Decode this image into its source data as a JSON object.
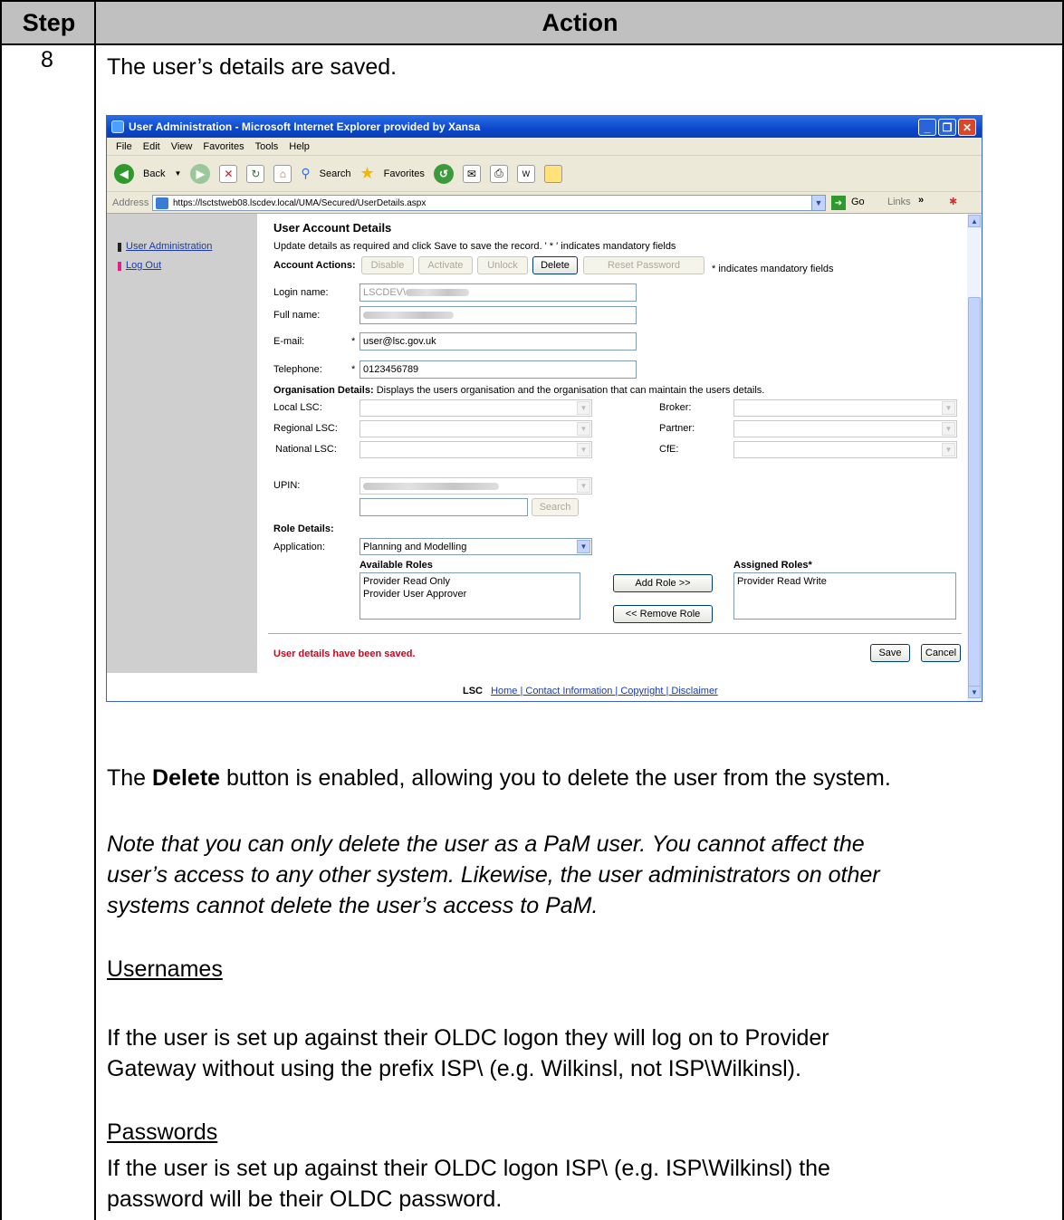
{
  "table": {
    "step_header": "Step",
    "action_header": "Action",
    "step_number": "8"
  },
  "content": {
    "intro": "The user’s details are saved.",
    "delete_prefix": "The ",
    "delete_bold": "Delete",
    "delete_suffix": " button is enabled, allowing you to delete the user from the system.",
    "note_line1": "Note that you can only delete the user as a PaM user.  You cannot affect the",
    "note_line2": "user’s access to any other system.  Likewise, the user administrators on other",
    "note_line3": "systems cannot delete the user’s access to PaM.",
    "usernames_heading": "Usernames",
    "usernames_line1": "If the user is set up against their OLDC logon they will log on to Provider",
    "usernames_line2": "Gateway without using the prefix ISP\\ (e.g. Wilkinsl, not ISP\\Wilkinsl).",
    "passwords_heading": "Passwords",
    "passwords_line1": "If the user is set up against their OLDC logon ISP\\ (e.g. ISP\\Wilkinsl) the",
    "passwords_line2": "password will be their OLDC password."
  },
  "browser": {
    "title": "User Administration - Microsoft Internet Explorer provided by Xansa",
    "menu": [
      "File",
      "Edit",
      "View",
      "Favorites",
      "Tools",
      "Help"
    ],
    "toolbar": {
      "back": "Back",
      "search": "Search",
      "favorites": "Favorites"
    },
    "address_label": "Address",
    "address_url": "https://lsctstweb08.lscdev.local/UMA/Secured/UserDetails.aspx",
    "go": "Go",
    "links": "Links"
  },
  "page": {
    "sidebar": [
      "User Administration",
      "Log Out"
    ],
    "heading": "User Account Details",
    "instructions": "Update details as required and click Save to save the record.   ' * ' indicates mandatory fields",
    "account_actions_label": "Account Actions:",
    "actions": {
      "disable": "Disable",
      "activate": "Activate",
      "unlock": "Unlock",
      "delete": "Delete",
      "reset": "Reset Password"
    },
    "mandatory_note": "* indicates mandatory fields",
    "fields": {
      "login_label": "Login name:",
      "login_value": "LSCDEV\\",
      "fullname_label": "Full name:",
      "email_label": "E-mail:",
      "email_value": "user@lsc.gov.uk",
      "telephone_label": "Telephone:",
      "telephone_value": "0123456789",
      "asterisk": "*"
    },
    "org": {
      "heading_bold": "Organisation Details:",
      "heading_rest": " Displays the users organisation and the organisation that can maintain the users details.",
      "local": "Local LSC:",
      "regional": "Regional LSC:",
      "national": "National LSC:",
      "broker": "Broker:",
      "partner": "Partner:",
      "cfe": "CfE:",
      "upin": "UPIN:",
      "search": "Search"
    },
    "roles": {
      "heading": "Role Details:",
      "application_label": "Application:",
      "application_value": "Planning and Modelling",
      "available_label": "Available Roles",
      "available": [
        "Provider Read Only",
        "Provider User Approver"
      ],
      "assigned_label": "Assigned Roles*",
      "assigned": [
        "Provider Read Write"
      ],
      "add": "Add Role >>",
      "remove": "<< Remove Role"
    },
    "saved_message": "User details have been saved.",
    "save": "Save",
    "cancel": "Cancel",
    "footer_lsc": "LSC",
    "footer_links": "Home | Contact Information | Copyright | Disclaimer"
  }
}
